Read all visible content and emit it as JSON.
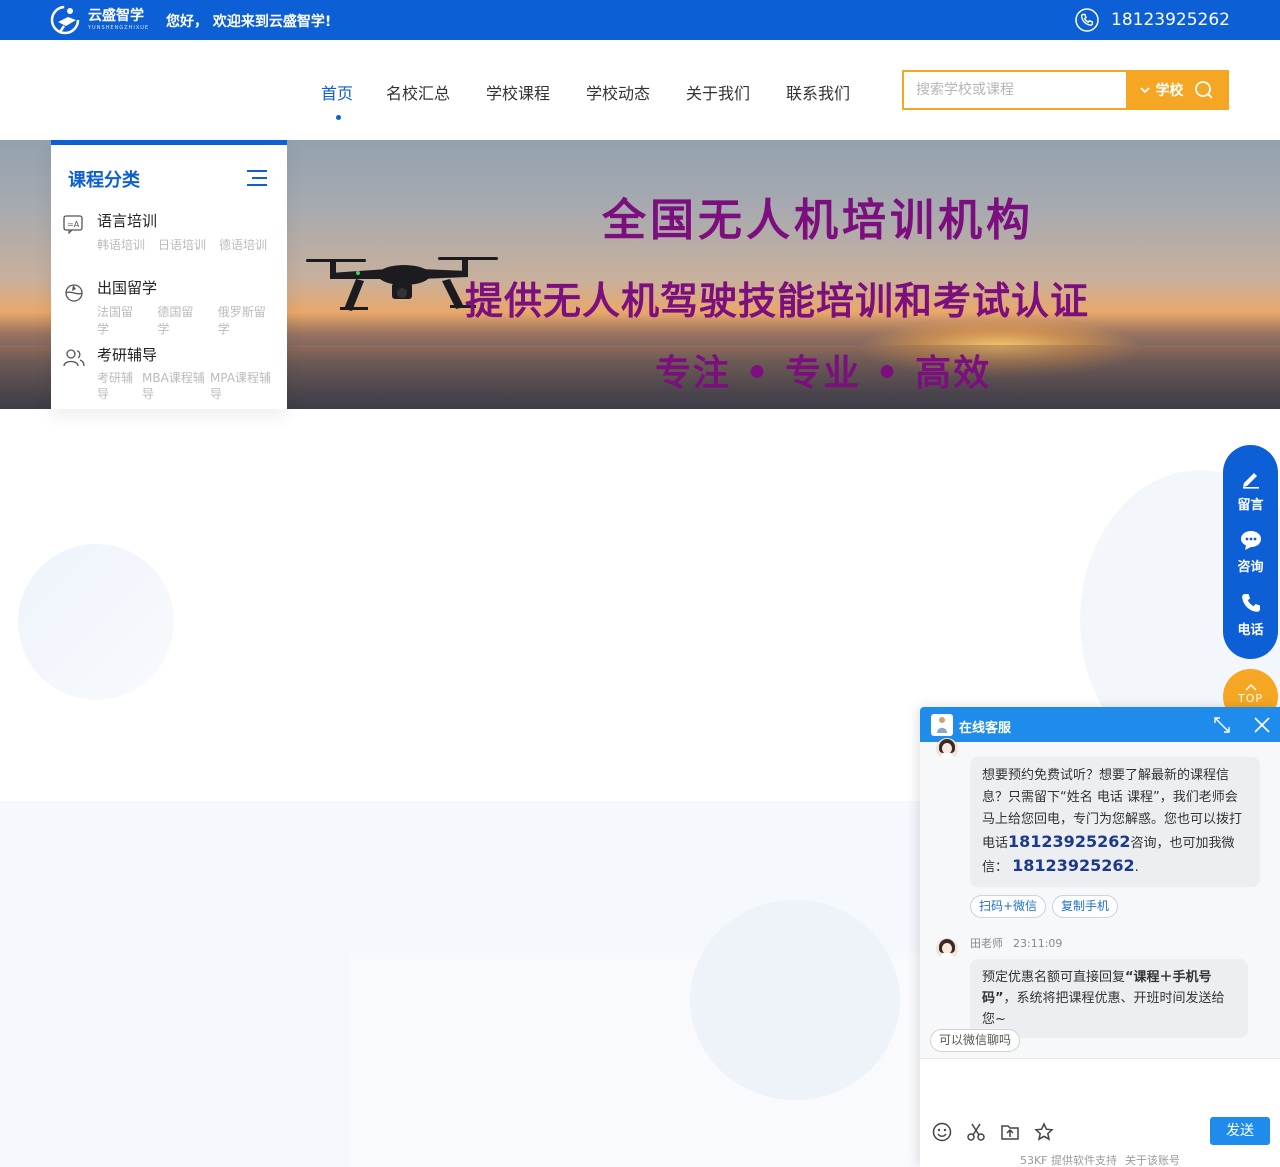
{
  "topbar": {
    "logo_cn": "云盛智学",
    "logo_en": "YUNSHENGZHIXUE",
    "welcome": "您好， 欢迎来到云盛智学!",
    "phone": "18123925262",
    "bg_color": "#0c5fd4"
  },
  "nav": {
    "items": [
      {
        "label": "首页",
        "active": true
      },
      {
        "label": "名校汇总"
      },
      {
        "label": "学校课程"
      },
      {
        "label": "学校动态"
      },
      {
        "label": "关于我们"
      },
      {
        "label": "联系我们"
      }
    ],
    "search": {
      "placeholder": "搜索学校或课程",
      "scope_label": "学校",
      "accent": "#f5a623"
    }
  },
  "banner": {
    "line1": "全国无人机培训机构",
    "line2": "提供无人机驾驶技能培训和考试认证",
    "line3": "专注 • 专业 • 高效",
    "text_color": "#7b0f7e"
  },
  "sidebar": {
    "title": "课程分类",
    "categories": [
      {
        "icon": "translate-icon",
        "name": "语言培训",
        "subs": [
          "韩语培训",
          "日语培训",
          "德语培训"
        ]
      },
      {
        "icon": "globe-plane-icon",
        "name": "出国留学",
        "subs": [
          "法国留学",
          "德国留学",
          "俄罗斯留学"
        ]
      },
      {
        "icon": "users-icon",
        "name": "考研辅导",
        "subs": [
          "考研辅导",
          "MBA课程辅导",
          "MPA课程辅导"
        ]
      }
    ]
  },
  "float_bar": {
    "items": [
      {
        "icon": "pencil-icon",
        "label": "留言"
      },
      {
        "icon": "chat-icon",
        "label": "咨询"
      },
      {
        "icon": "phone-icon",
        "label": "电话"
      }
    ],
    "top_label": "TOP"
  },
  "chat": {
    "title": "在线客服",
    "message1": {
      "text_a": "想要预约免费试听？想要了解最新的课程信息？只需留下“姓名 电话 课程”，我们老师会马上给您回电，专门为您解惑。您也可以拨打电话",
      "phone": "18123925262",
      "text_b": "咨询，也可加我微信：",
      "wechat": "18123925262",
      "text_c": "."
    },
    "quick_actions": [
      "扫码+微信",
      "复制手机"
    ],
    "message2": {
      "sender": "田老师",
      "time": "23:11:09",
      "text_a": "预定优惠名额可直接回复",
      "emphasis": "“课程＋手机号码”",
      "text_b": "，系统将把课程优惠、开班时间发送给您~"
    },
    "suggestion": "可以微信聊吗",
    "send_label": "发送",
    "powered": "53KF 提供软件支持",
    "account_link": "关于该账号"
  }
}
